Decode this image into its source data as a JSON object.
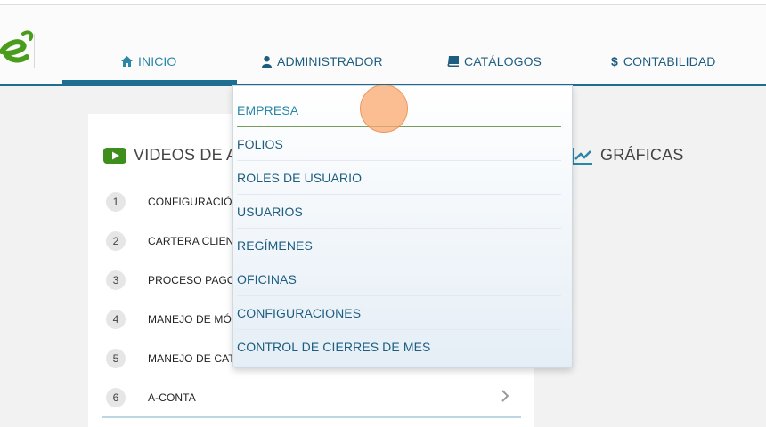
{
  "nav": {
    "items": [
      {
        "label": "INICIO",
        "icon": "home-icon"
      },
      {
        "label": "ADMINISTRADOR",
        "icon": "user-icon"
      },
      {
        "label": "CATÁLOGOS",
        "icon": "book-icon"
      },
      {
        "label": "CONTABILIDAD",
        "icon": "dollar-icon"
      }
    ]
  },
  "videos": {
    "title": "VIDEOS DE AY",
    "items": [
      {
        "num": "1",
        "label": "CONFIGURACIÓN"
      },
      {
        "num": "2",
        "label": "CARTERA CLIENT"
      },
      {
        "num": "3",
        "label": "PROCESO PAGO I"
      },
      {
        "num": "4",
        "label": "MANEJO DE MÓD"
      },
      {
        "num": "5",
        "label": "MANEJO DE CATÁ"
      },
      {
        "num": "6",
        "label": "A-CONTA"
      }
    ]
  },
  "charts": {
    "title": "GRÁFICAS"
  },
  "admin_menu": {
    "items": [
      "EMPRESA",
      "FOLIOS",
      "ROLES DE USUARIO",
      "USUARIOS",
      "REGÍMENES",
      "OFICINAS",
      "CONFIGURACIONES",
      "CONTROL DE CIERRES DE MES"
    ]
  },
  "colors": {
    "primary": "#1e6e93",
    "accent_green": "#3e8e1e",
    "link": "#1d5d80"
  }
}
